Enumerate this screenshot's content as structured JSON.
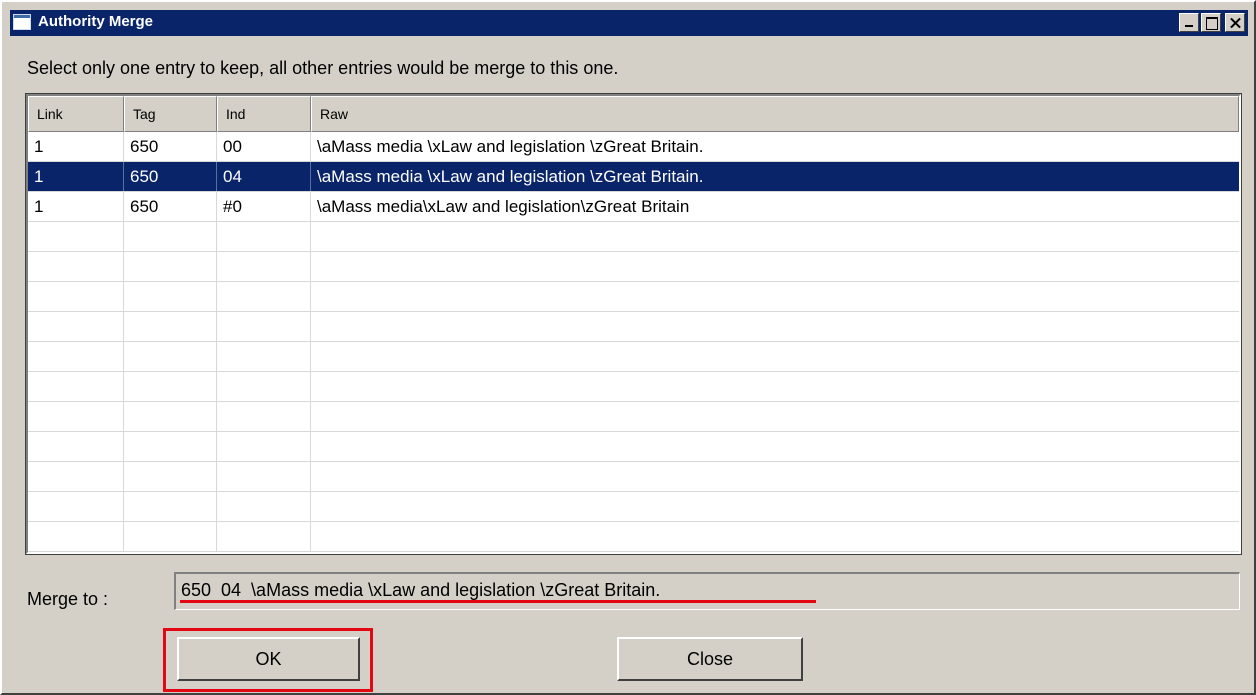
{
  "window": {
    "title": "Authority Merge",
    "title_bar_color": "#0a246a",
    "controls": [
      "minimize-icon",
      "maximize-icon",
      "close-icon"
    ]
  },
  "instruction": "Select only one entry to keep, all other entries would be merge to this one.",
  "table": {
    "columns": [
      "Link",
      "Tag",
      "Ind",
      "Raw"
    ],
    "rows": [
      {
        "link": "1",
        "tag": "650",
        "ind": "00",
        "raw": "\\aMass media \\xLaw and legislation \\zGreat Britain.",
        "selected": false
      },
      {
        "link": "1",
        "tag": "650",
        "ind": "04",
        "raw": "\\aMass media \\xLaw and legislation \\zGreat Britain.",
        "selected": true
      },
      {
        "link": "1",
        "tag": "650",
        "ind": "#0",
        "raw": "\\aMass media\\xLaw and legislation\\zGreat Britain",
        "selected": false
      }
    ],
    "selection_color": "#0a246a"
  },
  "merge": {
    "label": "Merge to :",
    "value": "650  04  \\aMass media \\xLaw and legislation \\zGreat Britain."
  },
  "buttons": {
    "ok": "OK",
    "close": "Close"
  },
  "annotation_color": "#e30613"
}
